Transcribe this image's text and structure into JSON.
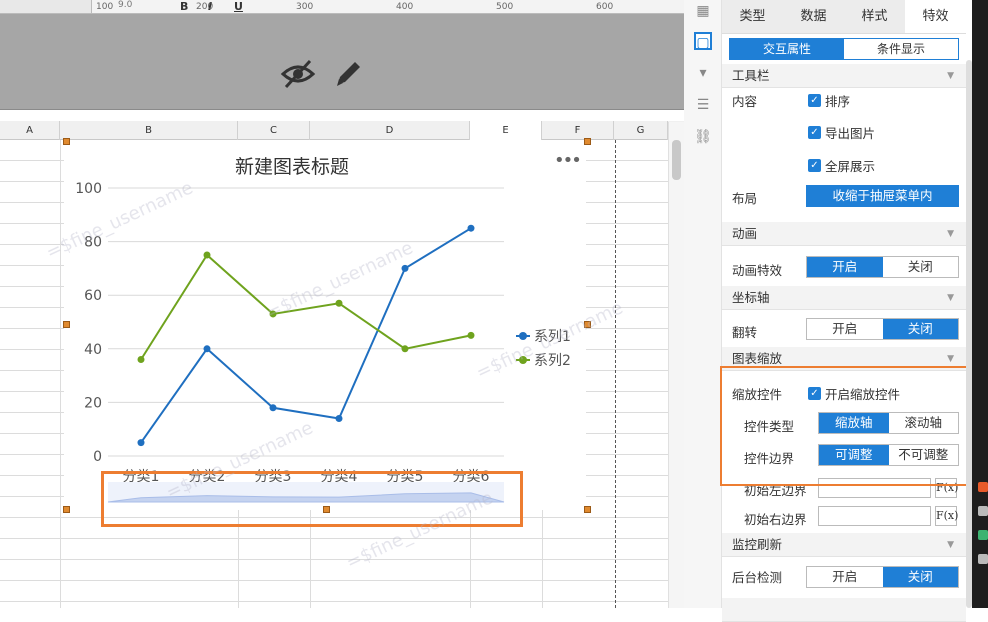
{
  "ruler": {
    "ticks": [
      "100",
      "200",
      "300",
      "400",
      "500",
      "600"
    ],
    "font_size": "9.0"
  },
  "columns": [
    "A",
    "B",
    "C",
    "D",
    "E",
    "F",
    "G"
  ],
  "chart_data": {
    "type": "line",
    "title": "新建图表标题",
    "categories": [
      "分类1",
      "分类2",
      "分类3",
      "分类4",
      "分类5",
      "分类6"
    ],
    "series": [
      {
        "name": "系列1",
        "color": "#1f6fc0",
        "values": [
          5,
          40,
          18,
          14,
          70,
          85
        ]
      },
      {
        "name": "系列2",
        "color": "#6fa31e",
        "values": [
          36,
          75,
          53,
          57,
          40,
          45
        ]
      }
    ],
    "ylim": [
      0,
      100
    ],
    "yticks": [
      "0",
      "20",
      "40",
      "60",
      "80",
      "100"
    ],
    "grid": true,
    "legend": "right",
    "zoom_slider": true
  },
  "watermark": "=$fine_username",
  "panel": {
    "tabs": [
      "类型",
      "数据",
      "样式",
      "特效"
    ],
    "active_tab": "特效",
    "subtabs": [
      "交互属性",
      "条件显示"
    ],
    "toolbar": {
      "section": "工具栏",
      "content_label": "内容",
      "options": [
        "排序",
        "导出图片",
        "全屏展示"
      ],
      "layout_label": "布局",
      "layout_value": "收缩于抽屉菜单内"
    },
    "animation": {
      "section": "动画",
      "label": "动画特效",
      "on": "开启",
      "off": "关闭"
    },
    "axis": {
      "section": "坐标轴",
      "label": "翻转",
      "on": "开启",
      "off": "关闭"
    },
    "zoom": {
      "section": "图表缩放",
      "label": "缩放控件",
      "enable": "开启缩放控件",
      "type_label": "控件类型",
      "type_a": "缩放轴",
      "type_b": "滚动轴",
      "border_label": "控件边界",
      "border_a": "可调整",
      "border_b": "不可调整",
      "left_label": "初始左边界",
      "right_label": "初始右边界",
      "fx": "F(x)"
    },
    "monitor": {
      "section": "监控刷新",
      "label": "后台检测",
      "on": "开启",
      "off": "关闭"
    }
  }
}
